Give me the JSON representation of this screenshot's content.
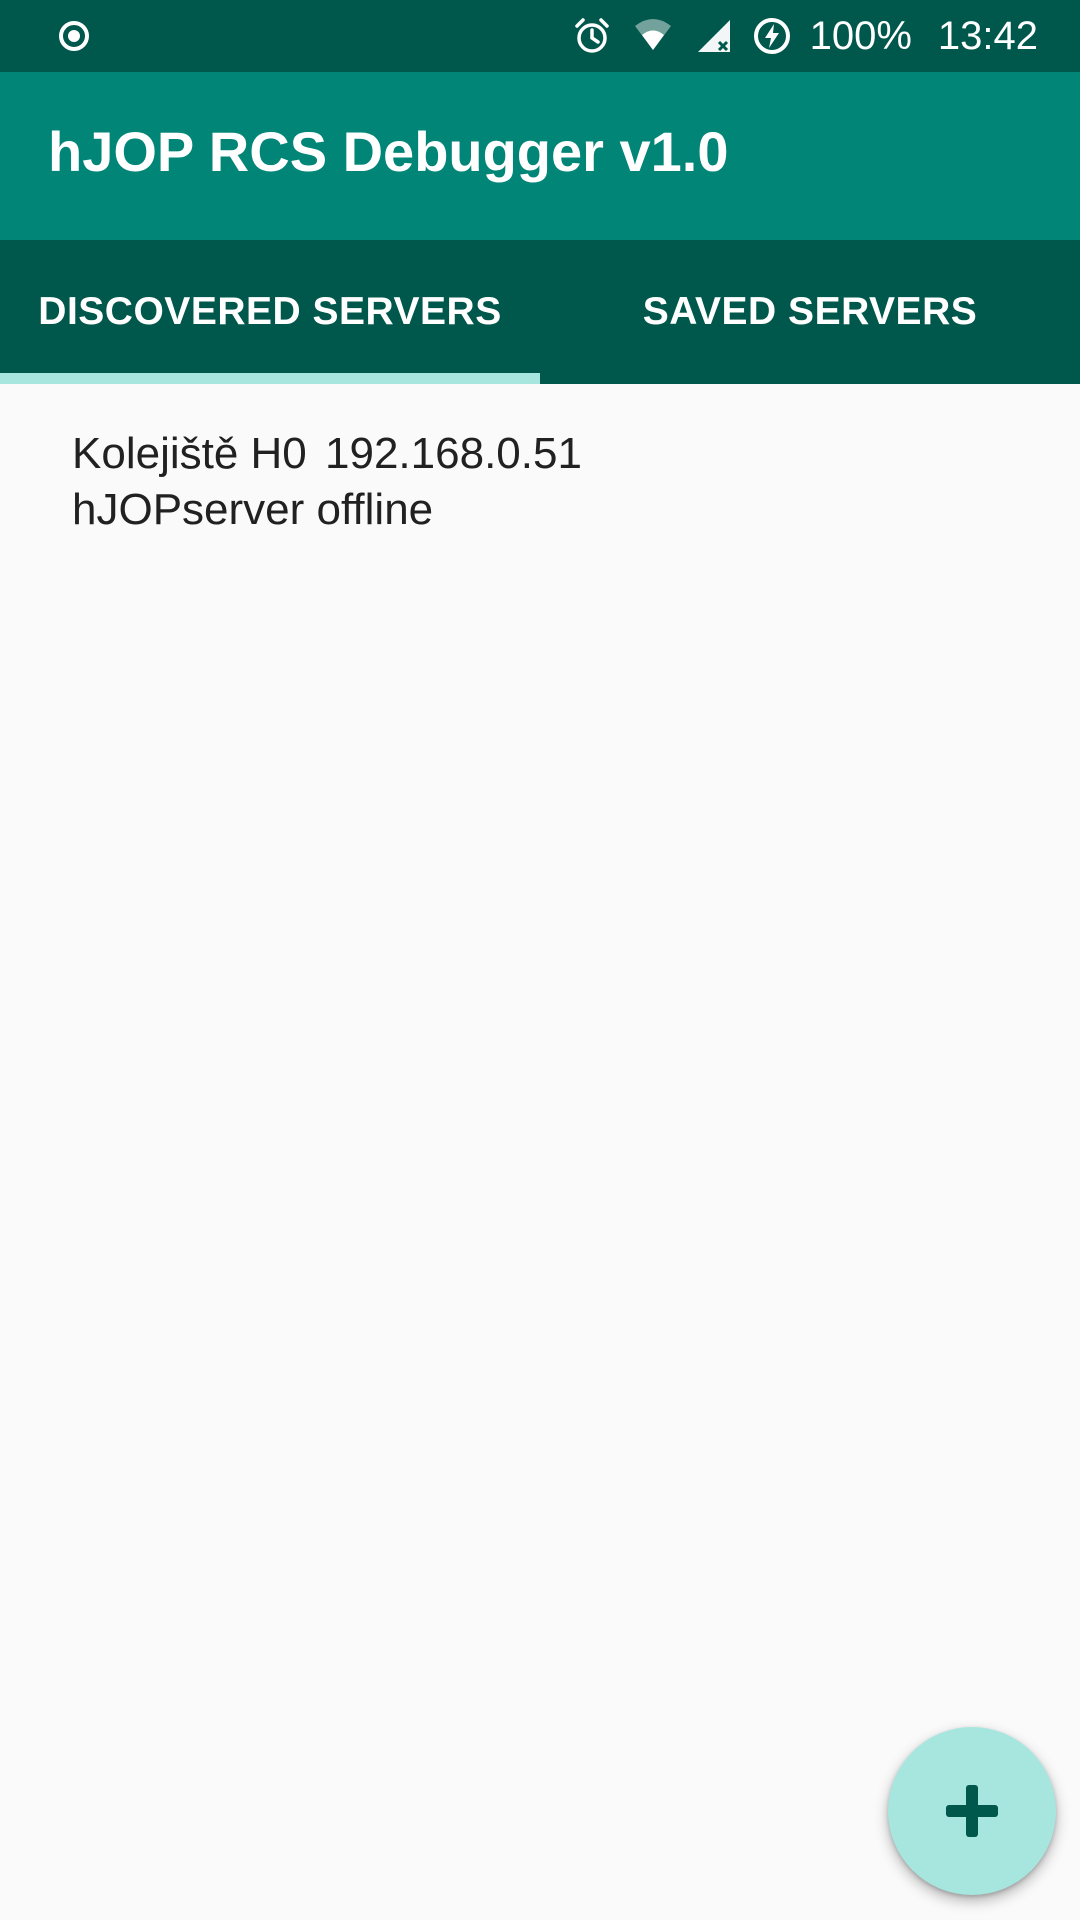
{
  "status_bar": {
    "left_icon": "record-icon",
    "icons": [
      "alarm-icon",
      "wifi-icon",
      "cell-signal-icon",
      "battery-charging-icon"
    ],
    "battery": "100%",
    "time": "13:42"
  },
  "app_bar": {
    "title": "hJOP RCS Debugger v1.0"
  },
  "tabs": [
    {
      "label": "DISCOVERED SERVERS",
      "selected": true
    },
    {
      "label": "SAVED SERVERS",
      "selected": false
    }
  ],
  "servers": [
    {
      "name": "Kolejiště H0",
      "ip": "192.168.0.51",
      "type": "hJOPserver",
      "status": "offline"
    }
  ],
  "fab": {
    "icon": "plus-icon"
  },
  "colors": {
    "status_bar": "#00574b",
    "app_bar": "#008577",
    "tab_bar": "#00574b",
    "tab_indicator": "#a7e6df",
    "fab": "#a7e6df",
    "fab_icon": "#00574b",
    "background": "#fafafa",
    "text": "#212121"
  }
}
